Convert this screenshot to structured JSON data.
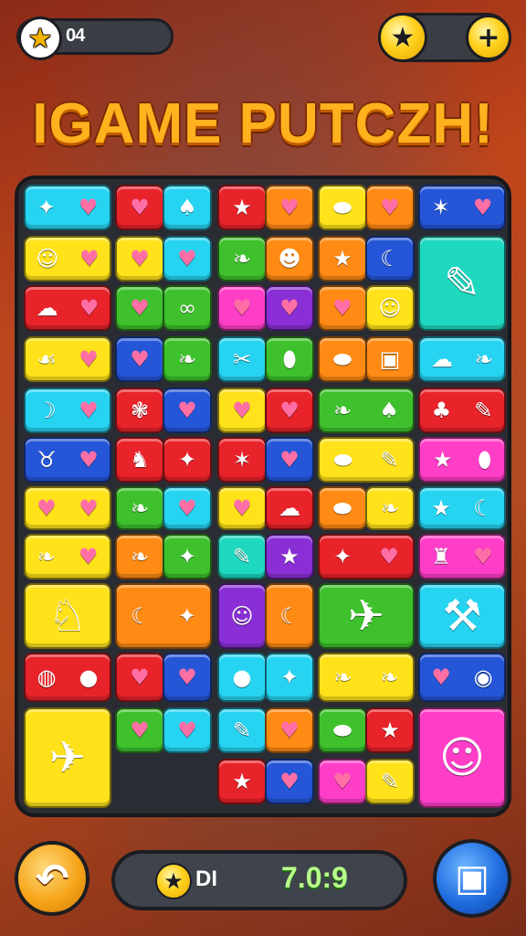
{
  "hud": {
    "left_counter": "04",
    "right_plus_label": "+",
    "star_glyph": "★"
  },
  "title": "IGAME PUTCZH!",
  "score_bar": {
    "label": "DI",
    "value": "7.0:9"
  },
  "buttons": {
    "undo_icon": "↶",
    "menu_icon": "▣"
  },
  "colors": {
    "yellow": "#ffe21a",
    "cyan": "#26d4f2",
    "red": "#e8232a",
    "orange": "#ff8a14",
    "blue": "#2556d8",
    "green": "#3ec12c",
    "pink": "#ff3ec8",
    "purple": "#8a2fd6",
    "teal": "#1fd8c0"
  },
  "tiles": [
    {
      "color": "cyan",
      "icons": [
        "✦",
        "♥"
      ]
    },
    {
      "color": "red",
      "icons": [
        "♥"
      ],
      "color2": "cyan",
      "icons2": [
        "♠"
      ]
    },
    {
      "color": "red",
      "icons": [
        "★"
      ],
      "color2": "orange",
      "icons2": [
        "♥"
      ]
    },
    {
      "color": "yellow",
      "icons": [
        "⬬"
      ],
      "color2": "orange",
      "icons2": [
        "♥"
      ]
    },
    {
      "color": "blue",
      "icons": [
        "✶",
        "♥"
      ]
    },
    {
      "color": "yellow",
      "icons": [
        "☺",
        "♥"
      ]
    },
    {
      "color": "yellow",
      "icons": [
        "♥"
      ],
      "color2": "cyan",
      "icons2": [
        "♥"
      ]
    },
    {
      "color": "green",
      "icons": [
        "❧"
      ],
      "color2": "orange",
      "icons2": [
        "☻"
      ]
    },
    {
      "color": "orange",
      "icons": [
        "★"
      ],
      "color2": "blue",
      "icons2": [
        "☾"
      ]
    },
    {
      "color": "teal",
      "icons": [
        "✎"
      ],
      "big": true
    },
    {
      "color": "red",
      "icons": [
        "☁",
        "♥"
      ]
    },
    {
      "color": "green",
      "icons": [
        "♥"
      ],
      "color2": "green",
      "icons2": [
        "∞"
      ]
    },
    {
      "color": "pink",
      "icons": [
        "♥"
      ],
      "color2": "purple",
      "icons2": [
        "♥"
      ]
    },
    {
      "color": "orange",
      "icons": [
        "♥"
      ],
      "color2": "yellow",
      "icons2": [
        "☺"
      ]
    },
    {
      "color": "yellow",
      "icons": [
        "☙",
        "♥"
      ]
    },
    {
      "color": "blue",
      "icons": [
        "♥"
      ],
      "color2": "green",
      "icons2": [
        "❧"
      ]
    },
    {
      "color": "cyan",
      "icons": [
        "✂"
      ],
      "color2": "green",
      "icons2": [
        "⬮"
      ]
    },
    {
      "color": "orange",
      "icons": [
        "⬬"
      ],
      "color2": "orange",
      "icons2": [
        "▣"
      ]
    },
    {
      "color": "cyan",
      "icons": [
        "☁",
        "❧"
      ]
    },
    {
      "color": "cyan",
      "icons": [
        "☽",
        "♥"
      ]
    },
    {
      "color": "red",
      "icons": [
        "❃"
      ],
      "color2": "blue",
      "icons2": [
        "♥"
      ]
    },
    {
      "color": "yellow",
      "icons": [
        "♥"
      ],
      "color2": "red",
      "icons2": [
        "♥"
      ]
    },
    {
      "color": "green",
      "icons": [
        "❧",
        "♠"
      ]
    },
    {
      "color": "red",
      "icons": [
        "♣",
        "✎"
      ]
    },
    {
      "color": "blue",
      "icons": [
        "♉",
        "♥"
      ]
    },
    {
      "color": "red",
      "icons": [
        "♞"
      ],
      "color2": "red",
      "icons2": [
        "✦"
      ]
    },
    {
      "color": "red",
      "icons": [
        "✶"
      ],
      "color2": "blue",
      "icons2": [
        "♥"
      ]
    },
    {
      "color": "yellow",
      "icons": [
        "⬬",
        "✎"
      ]
    },
    {
      "color": "pink",
      "icons": [
        "★",
        "⬮"
      ]
    },
    {
      "color": "yellow",
      "icons": [
        "♥",
        "♥"
      ]
    },
    {
      "color": "green",
      "icons": [
        "❧"
      ],
      "color2": "cyan",
      "icons2": [
        "♥"
      ]
    },
    {
      "color": "yellow",
      "icons": [
        "♥"
      ],
      "color2": "red",
      "icons2": [
        "☁"
      ]
    },
    {
      "color": "orange",
      "icons": [
        "⬬"
      ],
      "color2": "yellow",
      "icons2": [
        "❧"
      ]
    },
    {
      "color": "cyan",
      "icons": [
        "★",
        "☾"
      ]
    },
    {
      "color": "yellow",
      "icons": [
        "❧",
        "♥"
      ]
    },
    {
      "color": "orange",
      "icons": [
        "❧"
      ],
      "color2": "green",
      "icons2": [
        "✦"
      ]
    },
    {
      "color": "teal",
      "icons": [
        "✎"
      ],
      "color2": "purple",
      "icons2": [
        "★"
      ]
    },
    {
      "color": "red",
      "icons": [
        "✦",
        "♥"
      ]
    },
    {
      "color": "pink",
      "icons": [
        "♜",
        "♥"
      ]
    },
    {
      "color": "yellow",
      "icons": [
        "♘"
      ],
      "big": true
    },
    {
      "color": "orange",
      "icons": [
        "☾",
        "✦"
      ]
    },
    {
      "color": "purple",
      "icons": [
        "☺"
      ],
      "color2": "orange",
      "icons2": [
        "☾"
      ]
    },
    {
      "color": "green",
      "icons": [
        "✈"
      ],
      "big": true
    },
    {
      "color": "cyan",
      "icons": [
        "⚒"
      ],
      "big": true
    },
    {
      "color": "red",
      "icons": [
        "◍",
        "●"
      ]
    },
    {
      "color": "red",
      "icons": [
        "♥"
      ],
      "color2": "blue",
      "icons2": [
        "♥"
      ]
    },
    {
      "color": "cyan",
      "icons": [
        "●"
      ],
      "color2": "cyan",
      "icons2": [
        "✦"
      ]
    },
    {
      "color": "yellow",
      "icons": [
        "❧",
        "❧"
      ]
    },
    {
      "color": "blue",
      "icons": [
        "♥",
        "◉"
      ]
    },
    {
      "color": "yellow",
      "icons": [
        "✈"
      ],
      "big": true
    },
    {
      "color": "yellow",
      "icons": [
        "❧"
      ],
      "color2": "orange",
      "icons2": [
        "◍"
      ]
    },
    {
      "color": "cyan",
      "icons": [
        "✎"
      ],
      "color2": "orange",
      "icons2": [
        "♥"
      ]
    },
    {
      "color": "green",
      "icons": [
        "⬬"
      ],
      "color2": "red",
      "icons2": [
        "★"
      ]
    },
    {
      "color": "pink",
      "icons": [
        "☺"
      ],
      "big": true
    },
    {
      "color": "green",
      "icons": [
        "♥"
      ],
      "color2": "cyan",
      "icons2": [
        "♥"
      ]
    },
    {
      "color": "red",
      "icons": [
        "★"
      ],
      "color2": "blue",
      "icons2": [
        "♥"
      ]
    },
    {
      "color": "pink",
      "icons": [
        "♥"
      ],
      "color2": "yellow",
      "icons2": [
        "✎"
      ]
    }
  ]
}
